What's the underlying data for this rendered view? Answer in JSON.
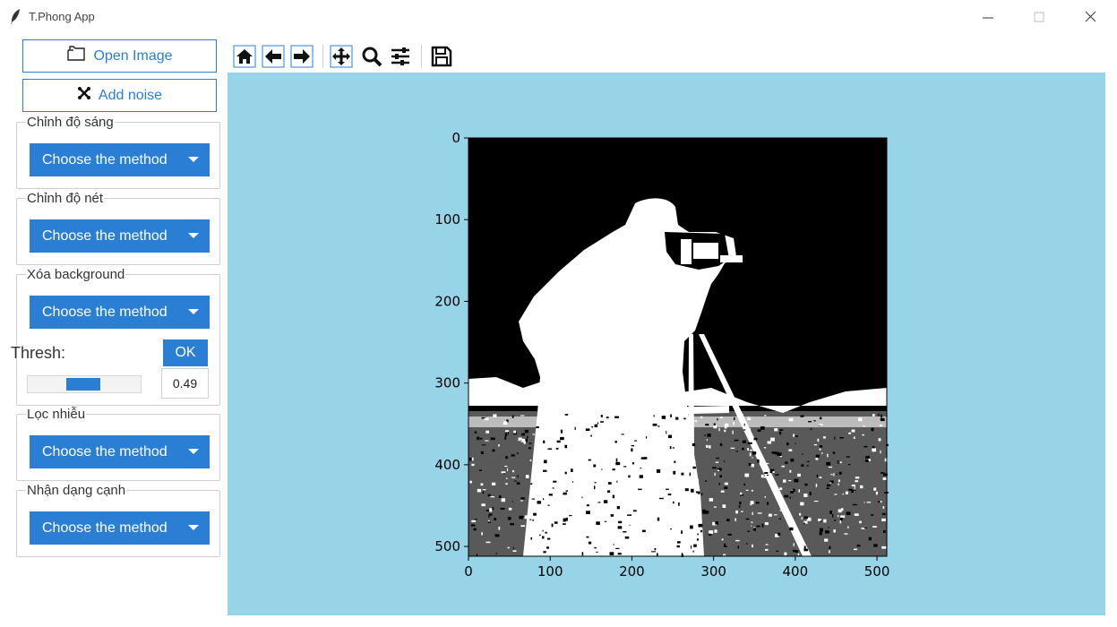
{
  "window": {
    "title": "T.Phong App",
    "icon": "feather-icon",
    "controls": [
      "minimize-icon",
      "maximize-icon",
      "close-icon"
    ]
  },
  "sidebar": {
    "open_image": {
      "label": "Open Image",
      "icon": "folder-icon"
    },
    "add_noise": {
      "label": "Add noise",
      "icon": "noise-icon"
    },
    "groups": [
      {
        "label": "Chỉnh độ sáng",
        "dropdown": "Choose the method"
      },
      {
        "label": "Chỉnh độ nét",
        "dropdown": "Choose the method"
      },
      {
        "label": "Xóa background",
        "dropdown": "Choose the method",
        "thresh_label": "Thresh:",
        "ok_label": "OK",
        "thresh_value": "0.49",
        "slider_fraction": 0.49
      },
      {
        "label": "Lọc nhiễu",
        "dropdown": "Choose the method"
      },
      {
        "label": "Nhận dạng cạnh",
        "dropdown": "Choose the method"
      }
    ]
  },
  "toolbar": {
    "buttons": [
      "home-icon",
      "back-icon",
      "forward-icon",
      "pan-icon",
      "zoom-icon",
      "configure-subplots-icon",
      "save-icon"
    ]
  },
  "colors": {
    "accent": "#2a7fd4",
    "canvas_bg": "#97d4e7"
  },
  "chart_data": {
    "type": "image",
    "x_ticks": [
      "0",
      "100",
      "200",
      "300",
      "400",
      "500"
    ],
    "y_ticks": [
      "0",
      "100",
      "200",
      "300",
      "400",
      "500"
    ],
    "xlim": [
      0,
      512
    ],
    "ylim": [
      512,
      0
    ],
    "image_description_visible": "binarized black-and-white image"
  }
}
